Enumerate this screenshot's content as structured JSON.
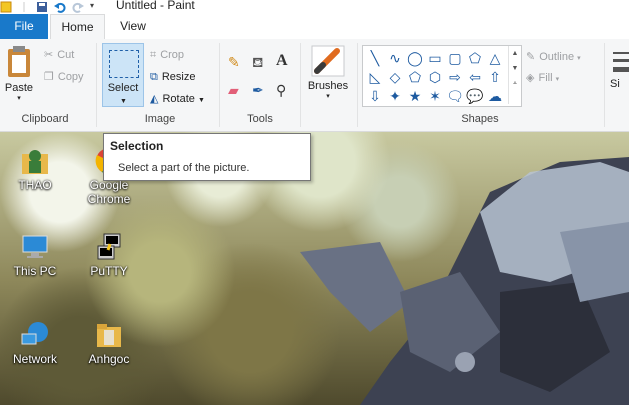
{
  "window": {
    "title": "Untitled - Paint"
  },
  "tabs": {
    "file": "File",
    "home": "Home",
    "view": "View"
  },
  "clipboard": {
    "paste": "Paste",
    "cut": "Cut",
    "copy": "Copy",
    "group_label": "Clipboard"
  },
  "image": {
    "select": "Select",
    "crop": "Crop",
    "resize": "Resize",
    "rotate": "Rotate",
    "group_label": "Image"
  },
  "tools": {
    "group_label": "Tools"
  },
  "brushes": {
    "label": "Brushes"
  },
  "shapes": {
    "group_label": "Shapes",
    "outline": "Outline",
    "fill": "Fill",
    "items": [
      "╲",
      "∿",
      "◯",
      "▭",
      "▢",
      "⬠",
      "△",
      "◺",
      "◇",
      "⬠",
      "⬡",
      "⇨",
      "⇦",
      "⇧",
      "⇩",
      "✦",
      "★",
      "✶",
      "🗨",
      "💬",
      "☁"
    ]
  },
  "size": {
    "label": "Si"
  },
  "tooltip": {
    "title": "Selection",
    "body": "Select a part of the picture."
  },
  "desktop": {
    "icons": [
      {
        "label": "THAO"
      },
      {
        "label": "Google Chrome"
      },
      {
        "label": "This PC"
      },
      {
        "label": "PuTTY"
      },
      {
        "label": "Network"
      },
      {
        "label": "Anhgoc"
      }
    ]
  },
  "colors": {
    "accent": "#1979ca",
    "selection_bg": "#cce4f7",
    "shape_blue": "#1d5aa0"
  }
}
